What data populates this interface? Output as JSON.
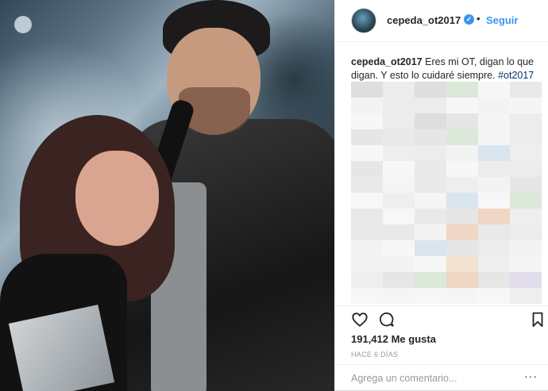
{
  "post": {
    "username": "cepeda_ot2017",
    "verified": true,
    "separator": "•",
    "follow_label": "Seguir",
    "caption_user": "cepeda_ot2017",
    "caption_text": " Eres mi OT, digan lo que digan. Y esto lo cuidaré siempre. ",
    "hashtag": "#ot2017",
    "likes": "191,412 Me gusta",
    "time_ago": "HACE 6 DÍAS",
    "comment_placeholder": "Agrega un comentario...",
    "more_label": "···"
  },
  "icons": {
    "avatar": "avatar",
    "verified": "verified-badge-icon",
    "like": "heart-icon",
    "comment": "comment-icon",
    "save": "bookmark-icon",
    "more": "more-options-icon"
  },
  "colors": {
    "link": "#3897f0",
    "hashtag": "#003569",
    "muted": "#999999",
    "text": "#262626"
  }
}
